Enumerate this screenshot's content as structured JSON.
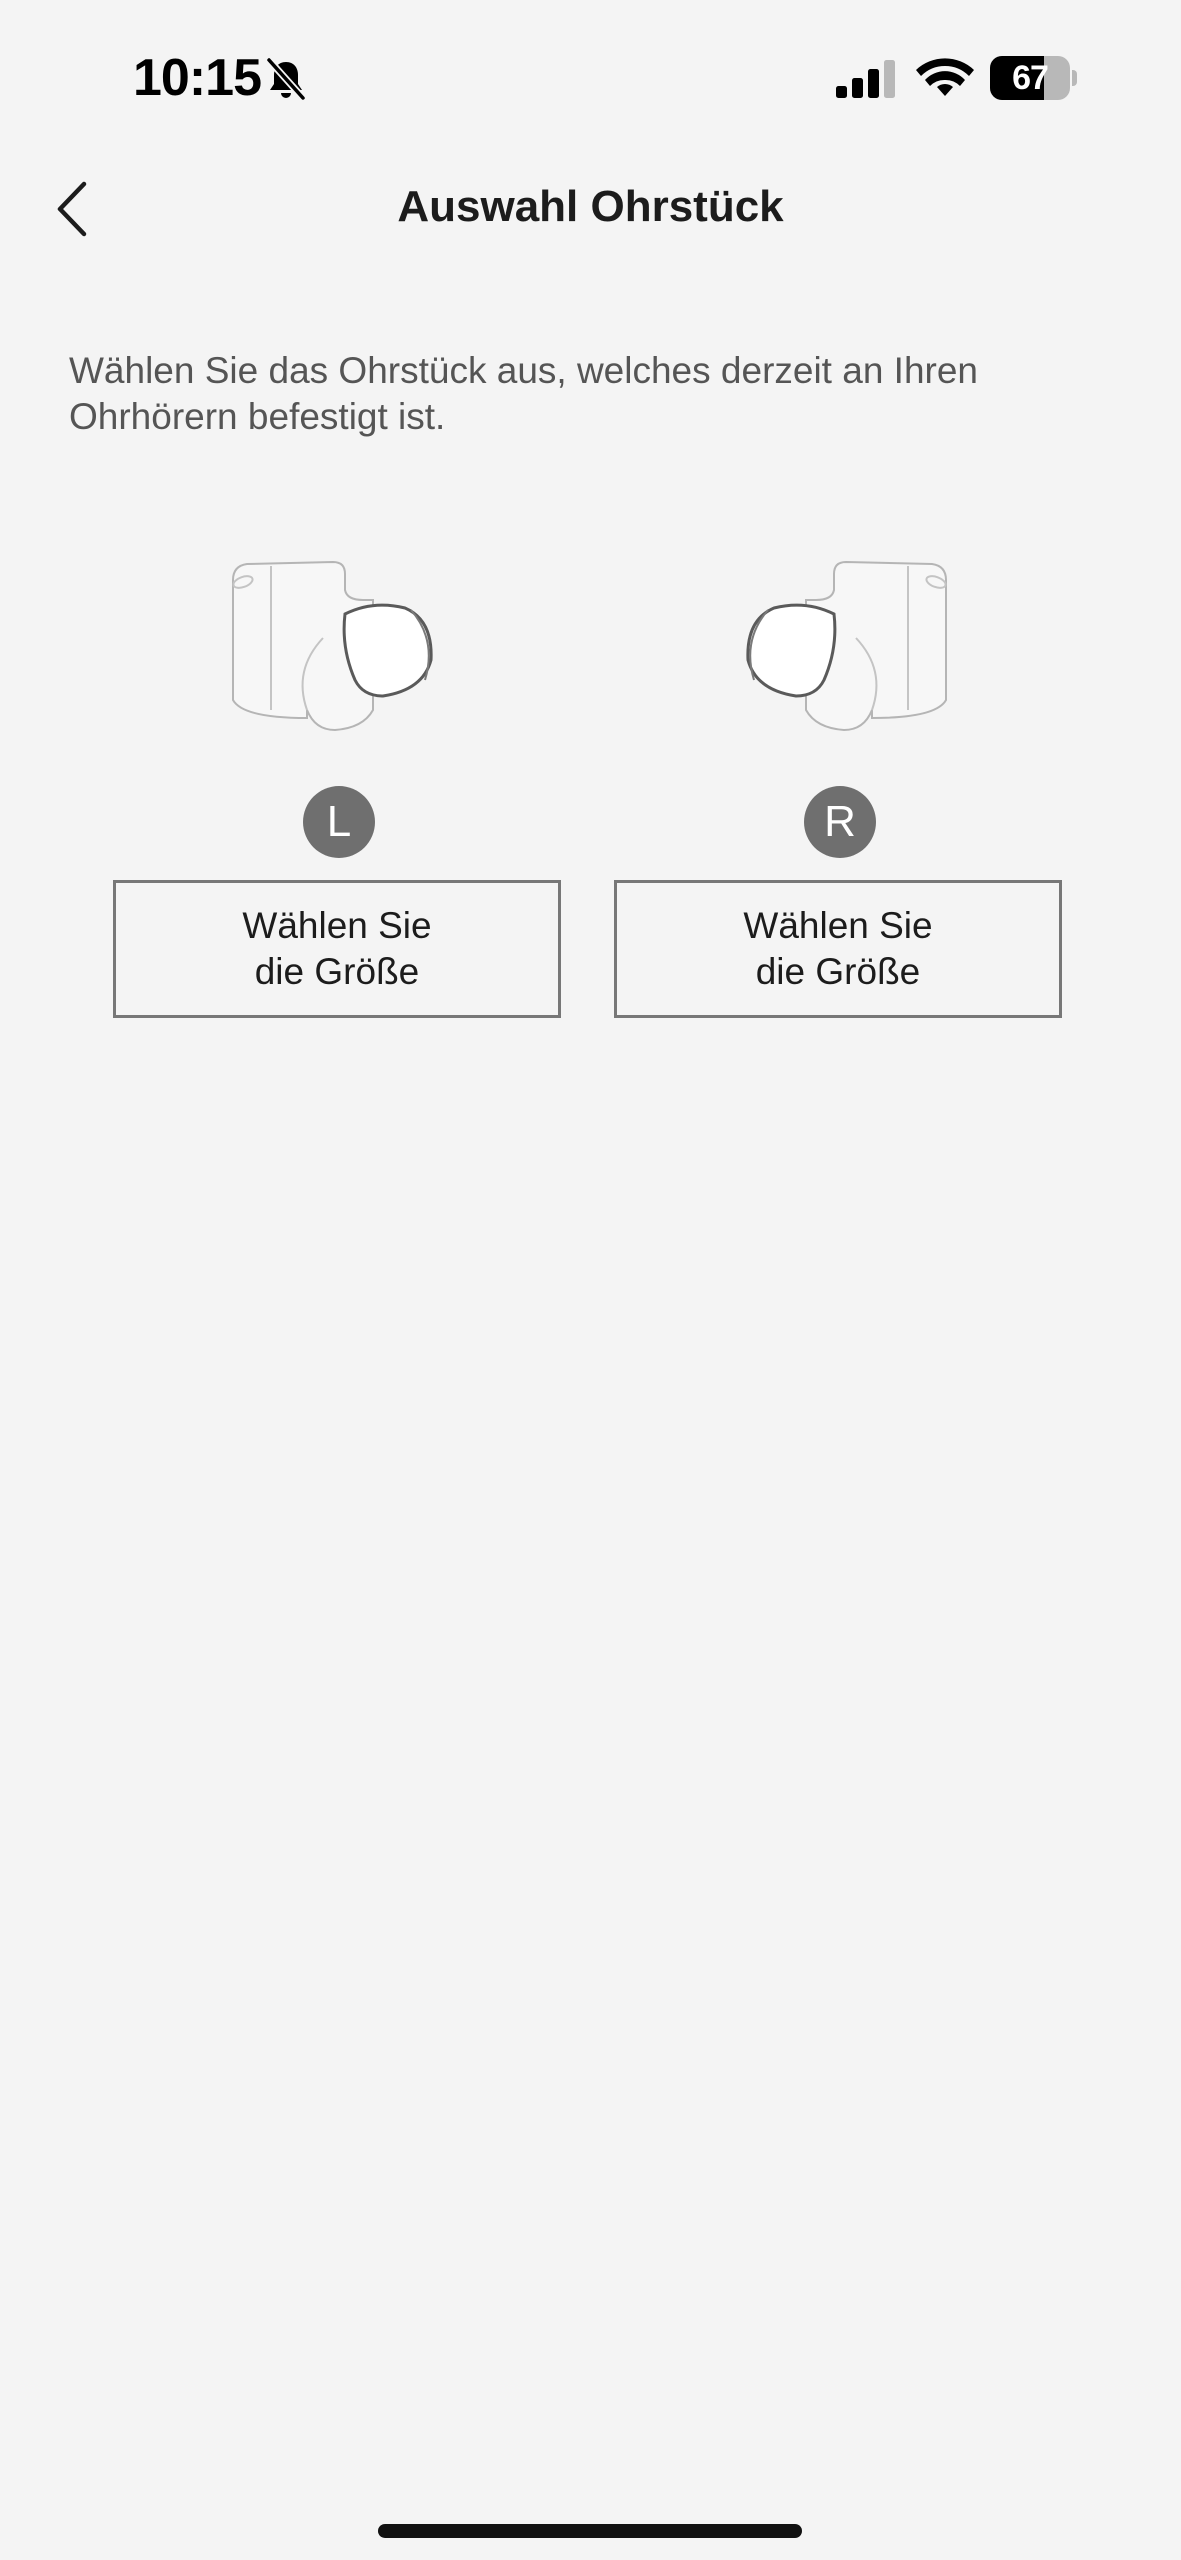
{
  "status_bar": {
    "time": "10:15",
    "battery_level": "67",
    "icons": [
      "bell-slash-icon",
      "cellular-signal-icon",
      "wifi-icon",
      "battery-icon"
    ]
  },
  "nav": {
    "back_icon": "chevron-left-icon",
    "title": "Auswahl Ohrstück"
  },
  "main": {
    "instruction": "Wählen Sie das Ohrstück aus, welches derzeit an Ihren Ohrhörern befestigt ist.",
    "sides": [
      {
        "badge": "L",
        "illustration": "left-earbud-illustration",
        "button_line1": "Wählen Sie",
        "button_line2": "die Größe"
      },
      {
        "badge": "R",
        "illustration": "right-earbud-illustration",
        "button_line1": "Wählen Sie",
        "button_line2": "die Größe"
      }
    ]
  },
  "colors": {
    "background": "#f4f4f4",
    "badge": "#6f6f6f",
    "button_border": "#777777",
    "text": "#1c1c1c"
  }
}
